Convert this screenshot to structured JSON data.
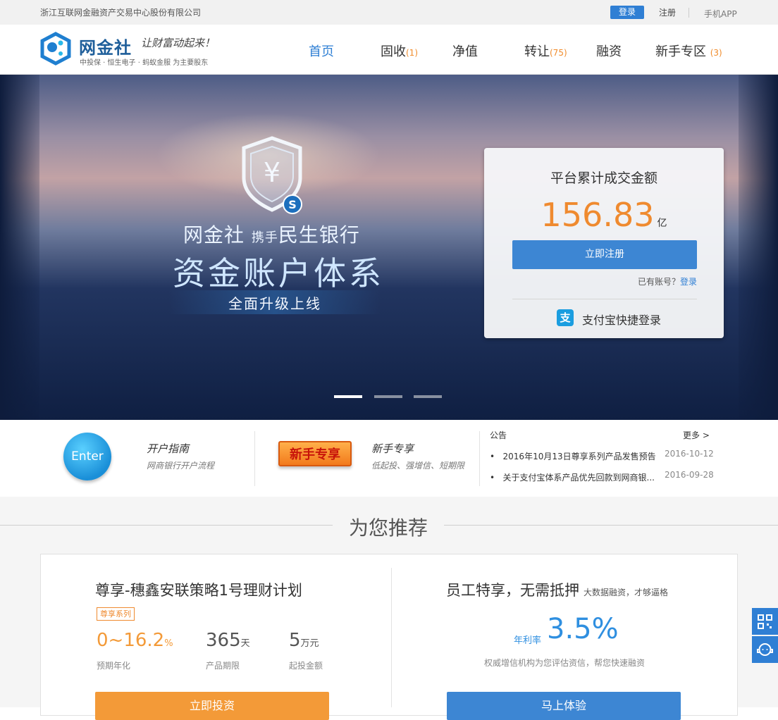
{
  "topbar": {
    "company": "浙江互联网金融资产交易中心股份有限公司",
    "login": "登录",
    "register": "注册",
    "app": "手机APP"
  },
  "logo": {
    "name": "网金社",
    "slogan": "让财富动起来！",
    "sub": "中投保 · 恒生电子 · 蚂蚁金服    为主要股东"
  },
  "nav": [
    {
      "label": "首页",
      "count": ""
    },
    {
      "label": "固收",
      "count": "(1)"
    },
    {
      "label": "净值",
      "count": ""
    },
    {
      "label": "转让",
      "count": "(75)"
    },
    {
      "label": "融资",
      "count": ""
    },
    {
      "label": "新手专区",
      "count": "(3)"
    }
  ],
  "banner": {
    "line1_a": "网金社",
    "line1_b": "携手",
    "line1_c": "民生银行",
    "line2": "资金账户体系",
    "line3": "全面升级上线"
  },
  "card": {
    "title": "平台累计成交金额",
    "amount": "156.83",
    "unit": "亿",
    "register_btn": "立即注册",
    "has_account": "已有账号？",
    "login_link": "登录",
    "alipay_icon": "支",
    "alipay": "支付宝快捷登录"
  },
  "features": {
    "enter": "Enter",
    "f1_title": "开户指南",
    "f1_sub": "网商银行开户流程",
    "badge": "新手专享",
    "f2_title": "新手专享",
    "f2_sub": "低起投、强增信、短期限"
  },
  "notice": {
    "title": "公告",
    "more": "更多 >",
    "items": [
      {
        "text": "2016年10月13日尊享系列产品发售预告",
        "date": "2016-10-12"
      },
      {
        "text": "关于支付宝体系产品优先回款到网商银...",
        "date": "2016-09-28"
      }
    ]
  },
  "recommend": {
    "title": "为您推荐",
    "p1": {
      "title": "尊享-穗鑫安联策略1号理财计划",
      "tag": "尊享系列",
      "rate": "0~16.2",
      "rate_unit": "%",
      "rate_label": "预期年化",
      "term": "365",
      "term_unit": "天",
      "term_label": "产品期限",
      "min": "5",
      "min_unit": "万元",
      "min_label": "起投金额",
      "btn": "立即投资"
    },
    "p2": {
      "title": "员工特享，无需抵押",
      "subtitle": "大数据融资，才够逼格",
      "rate_label": "年利率",
      "rate": "3.5%",
      "desc": "权威增信机构为您评估资信，帮您快速融资",
      "btn": "马上体验"
    }
  },
  "colors": {
    "brand_blue": "#2f7fd4",
    "orange": "#ef8a2f"
  },
  "icons": [
    "qr-code-icon",
    "customer-service-icon",
    "alipay-icon",
    "shield-yen-icon"
  ]
}
